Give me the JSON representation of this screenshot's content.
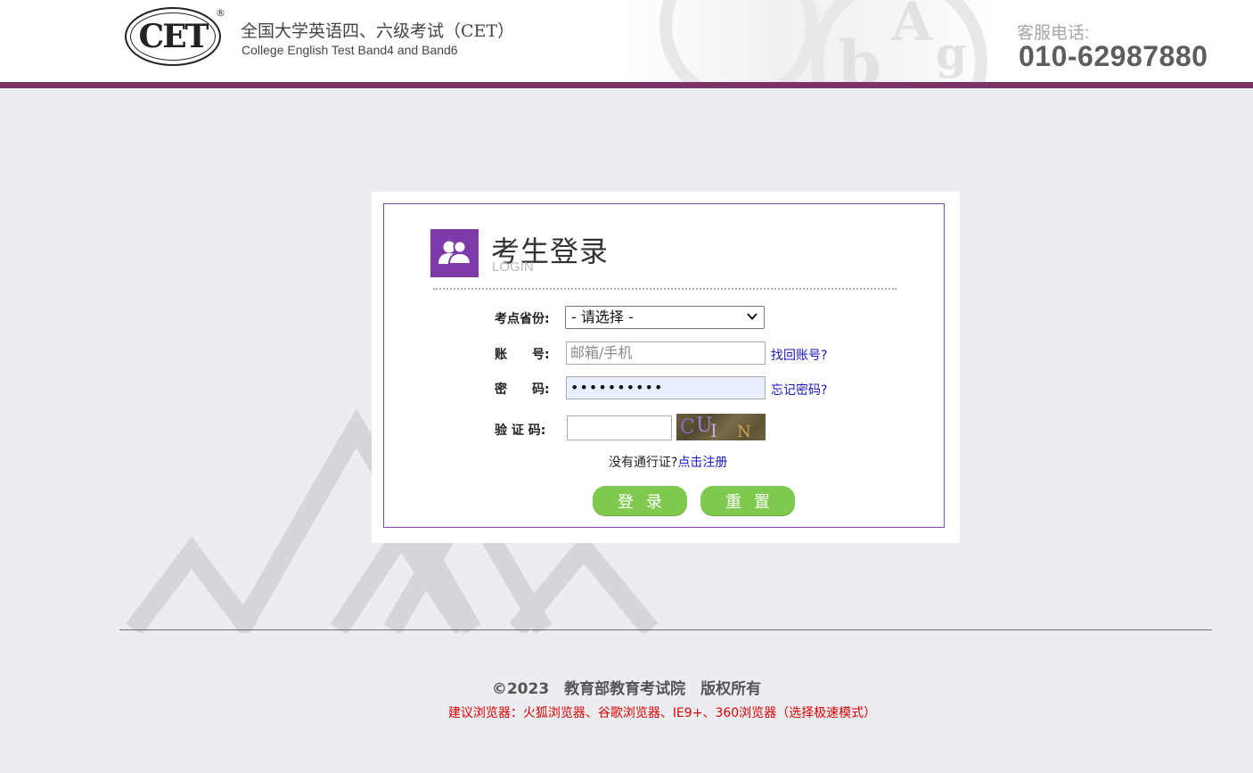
{
  "header": {
    "logo_text": "CET",
    "logo_reg": "®",
    "title_cn": "全国大学英语四、六级考试（CET）",
    "title_en": "College English Test Band4 and Band6",
    "service_label": "客服电话:",
    "service_phone": "010-62987880"
  },
  "login": {
    "title": "考生登录",
    "subtitle": "LOGIN",
    "province_label": "考点省份:",
    "province_value": "- 请选择 -",
    "account_label": "账　　号:",
    "account_placeholder": "邮箱/手机",
    "find_account_link": "找回账号?",
    "password_label": "密　　码:",
    "password_value": "••••••••••",
    "forgot_password_link": "忘记密码?",
    "captcha_label": "验 证 码:",
    "captcha_text": "CUIN",
    "no_pass_text": "没有通行证?",
    "register_link": "点击注册",
    "login_button": "登录",
    "reset_button": "重置"
  },
  "footer": {
    "copyright": "©2023　教育部教育考试院　版权所有",
    "browser_tip": "建议浏览器：火狐浏览器、谷歌浏览器、IE9+、360浏览器（选择极速模式）"
  },
  "colors": {
    "brand_purple": "#7b3565",
    "card_border": "#8a47b8",
    "button_green": "#7fca4e",
    "link_blue": "#1616c8",
    "tip_red": "#e00000"
  }
}
